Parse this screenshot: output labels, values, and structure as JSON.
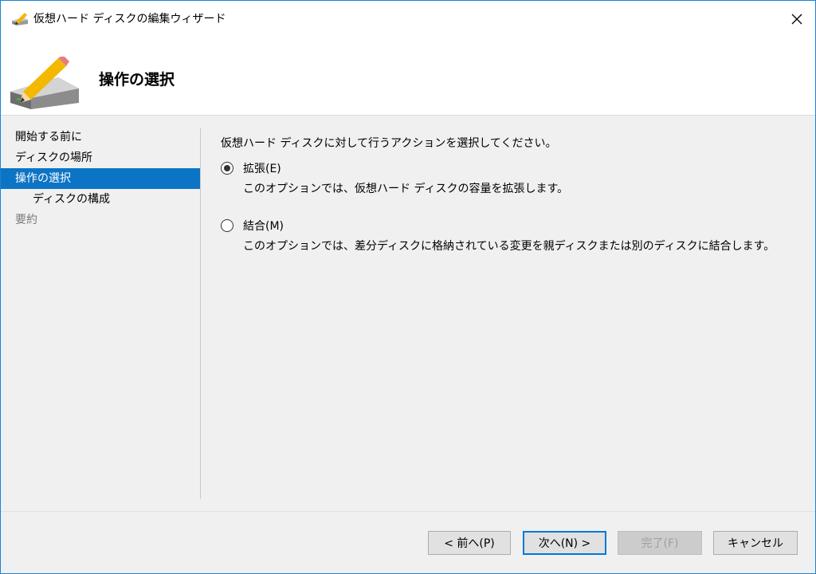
{
  "window": {
    "title": "仮想ハード ディスクの編集ウィザード",
    "close_glyph": "✕"
  },
  "header": {
    "title": "操作の選択"
  },
  "nav": {
    "items": [
      {
        "label": "開始する前に"
      },
      {
        "label": "ディスクの場所"
      },
      {
        "label": "操作の選択"
      },
      {
        "label": "ディスクの構成"
      },
      {
        "label": "要約"
      }
    ]
  },
  "content": {
    "instruction": "仮想ハード ディスクに対して行うアクションを選択してください。",
    "options": [
      {
        "label": "拡張(E)",
        "description": "このオプションでは、仮想ハード ディスクの容量を拡張します。",
        "selected": true
      },
      {
        "label": "結合(M)",
        "description": "このオプションでは、差分ディスクに格納されている変更を親ディスクまたは別のディスクに結合します。",
        "selected": false
      }
    ]
  },
  "buttons": {
    "prev": "< 前へ(P)",
    "next": "次へ(N) >",
    "finish": "完了(F)",
    "cancel": "キャンセル"
  },
  "colors": {
    "accent": "#0c74c4",
    "window_border": "#1883d7"
  }
}
